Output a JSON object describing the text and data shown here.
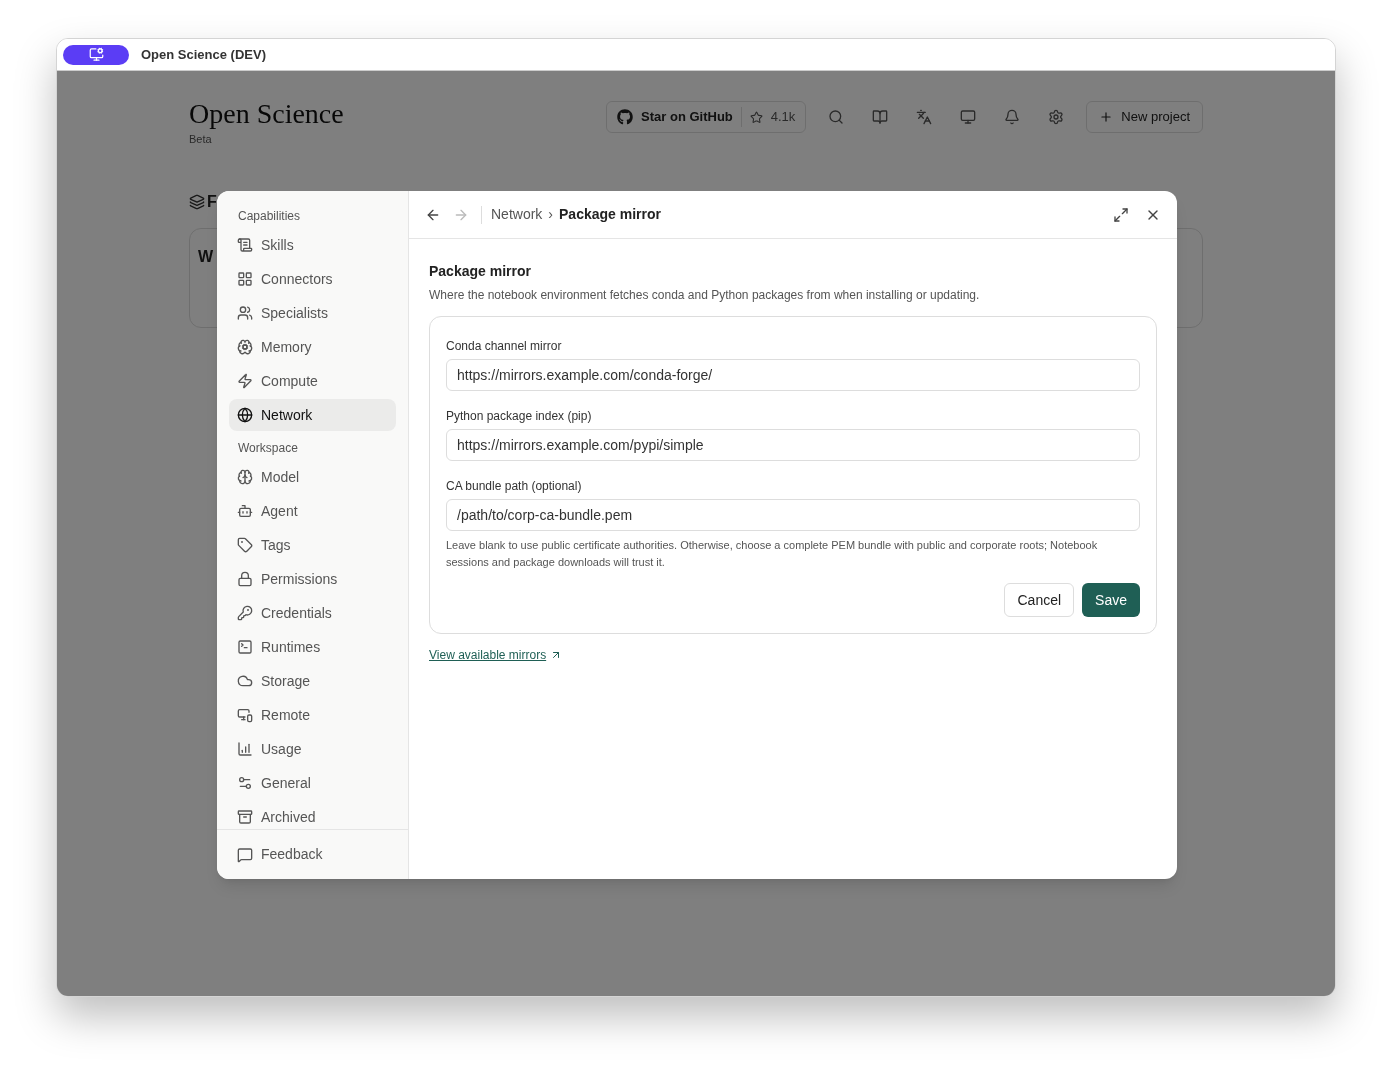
{
  "window": {
    "title": "Open Science (DEV)"
  },
  "app": {
    "title": "Open Science",
    "subtitle": "Beta",
    "github_label": "Star on GitHub",
    "github_stars": "4.1k",
    "new_project": "New project",
    "section_title": "F",
    "card_text": "W"
  },
  "dialog": {
    "sidebar": {
      "sections": [
        {
          "heading": "Capabilities",
          "items": [
            {
              "label": "Skills",
              "selected": false
            },
            {
              "label": "Connectors",
              "selected": false
            },
            {
              "label": "Specialists",
              "selected": false
            },
            {
              "label": "Memory",
              "selected": false
            },
            {
              "label": "Compute",
              "selected": false
            },
            {
              "label": "Network",
              "selected": true
            }
          ]
        },
        {
          "heading": "Workspace",
          "items": [
            {
              "label": "Model",
              "selected": false
            },
            {
              "label": "Agent",
              "selected": false
            },
            {
              "label": "Tags",
              "selected": false
            },
            {
              "label": "Permissions",
              "selected": false
            },
            {
              "label": "Credentials",
              "selected": false
            },
            {
              "label": "Runtimes",
              "selected": false
            },
            {
              "label": "Storage",
              "selected": false
            },
            {
              "label": "Remote",
              "selected": false
            },
            {
              "label": "Usage",
              "selected": false
            },
            {
              "label": "General",
              "selected": false
            },
            {
              "label": "Archived",
              "selected": false
            }
          ]
        }
      ],
      "footer_item": "Feedback"
    },
    "nav": {
      "back_disabled": false,
      "forward_disabled": true
    },
    "breadcrumb": [
      "Network",
      "Package mirror"
    ],
    "breadcrumb_separator": "›",
    "heading": "Package mirror",
    "description": "Where the notebook environment fetches conda and Python packages from when installing or updating.",
    "fields": [
      {
        "label": "Conda channel mirror",
        "value": "https://mirrors.example.com/conda-forge/"
      },
      {
        "label": "Python package index (pip)",
        "value": "https://mirrors.example.com/pypi/simple"
      },
      {
        "label": "CA bundle path (optional)",
        "value": "/path/to/corp-ca-bundle.pem"
      }
    ],
    "help": "Leave blank to use public certificate authorities. Otherwise, choose a complete PEM bundle with public and corporate roots; Notebook sessions and package downloads will trust it.",
    "cancel": "Cancel",
    "save": "Save",
    "link": "View available mirrors"
  }
}
